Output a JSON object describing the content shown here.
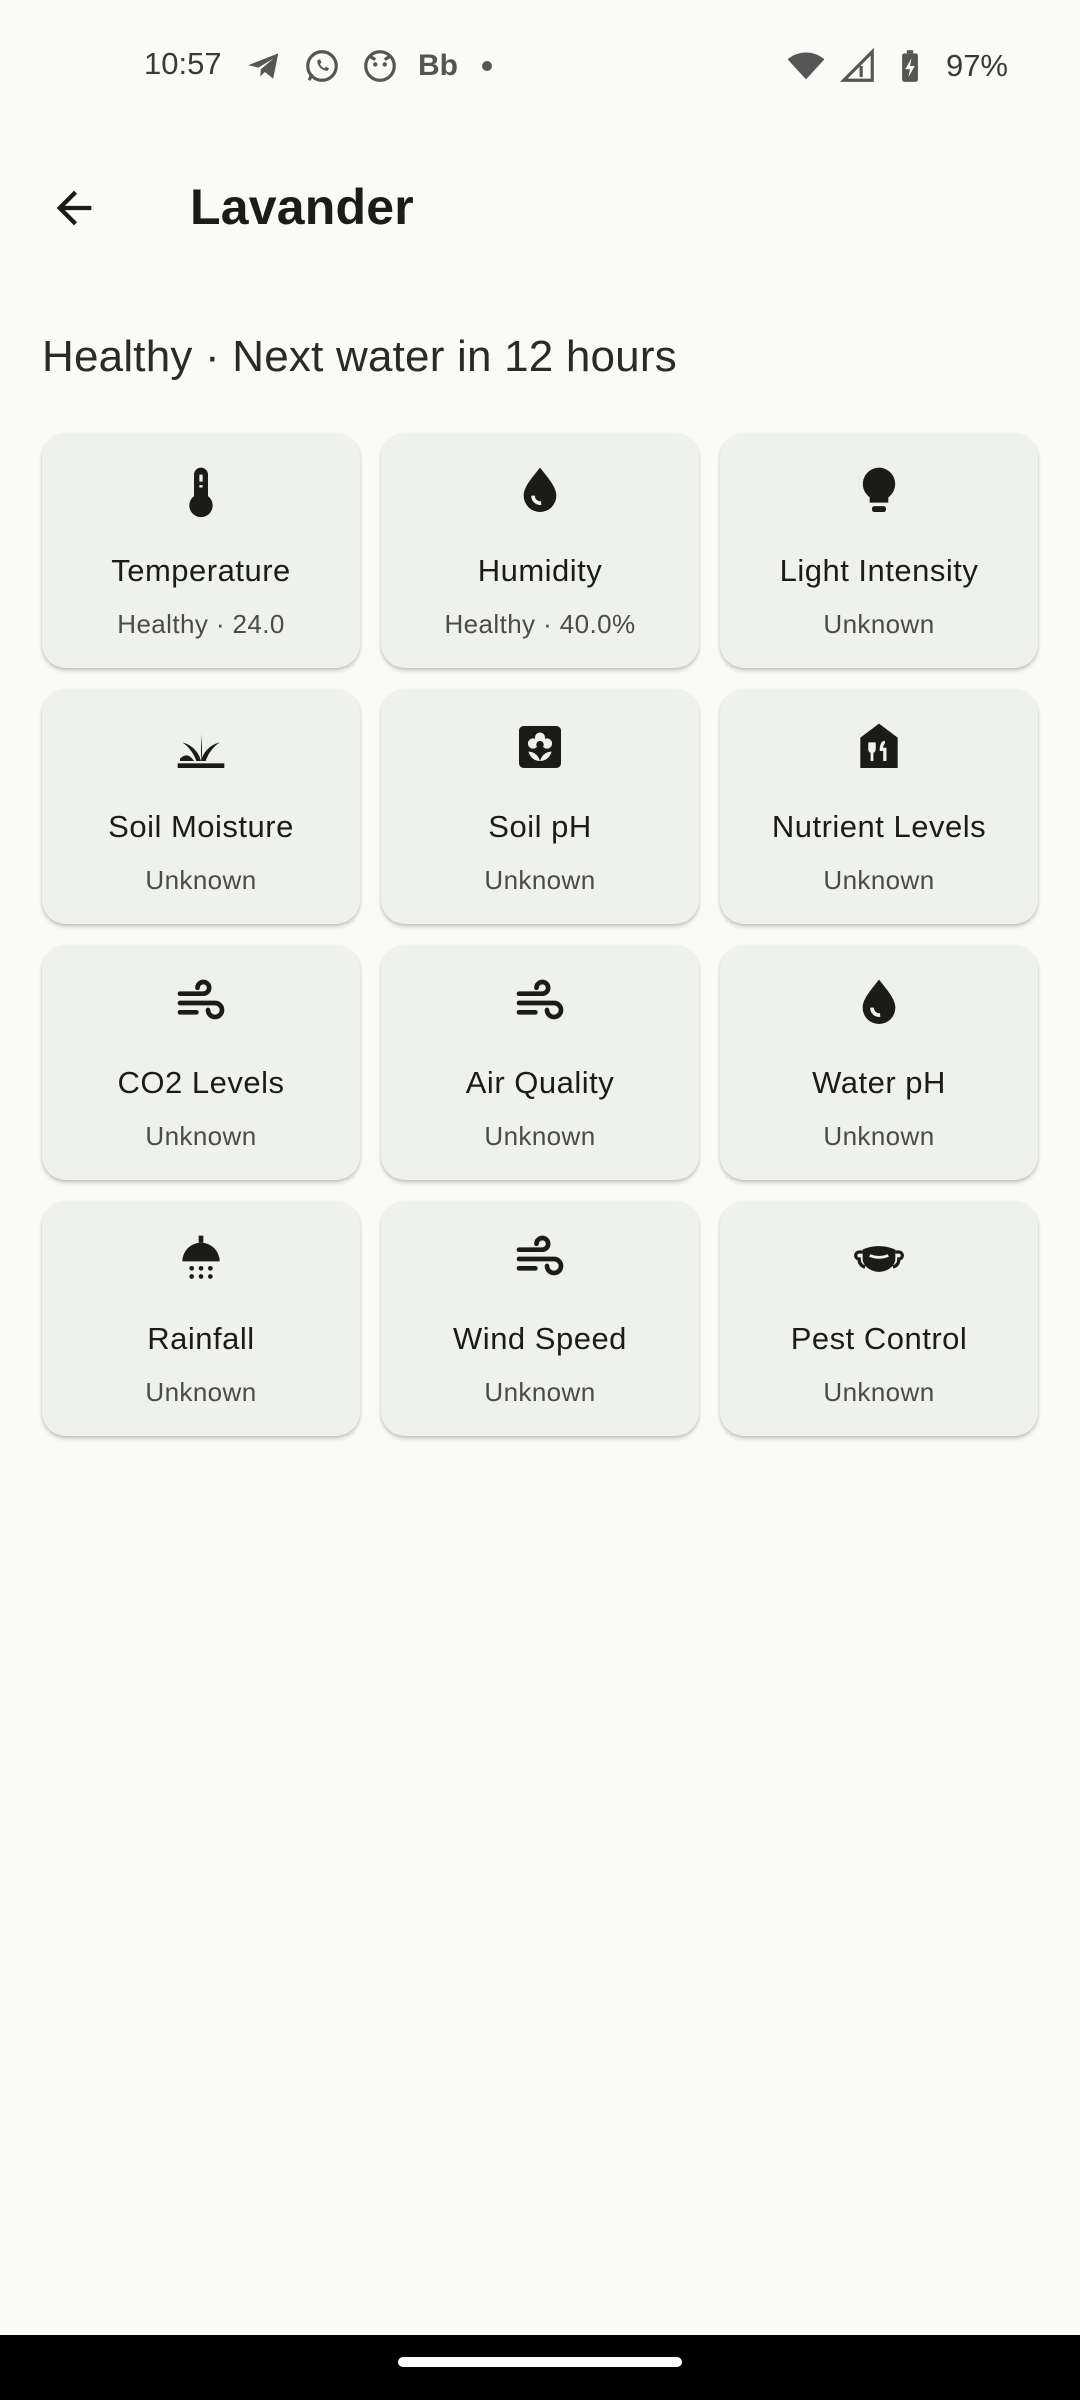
{
  "status_bar": {
    "time": "10:57",
    "left_icons": [
      "telegram-icon",
      "whatsapp-icon",
      "cat-icon",
      "bb-icon",
      "dot-icon"
    ],
    "bb_label": "Bb",
    "right_icons": [
      "wifi-icon",
      "signal-icon",
      "battery-charging-icon"
    ],
    "battery": "97%"
  },
  "app_bar": {
    "back_icon": "arrow-back-icon",
    "title": "Lavander"
  },
  "summary": "Healthy · Next water in 12 hours",
  "colors": {
    "background": "#fafbf5",
    "card": "#eef2ea",
    "text": "#1b1c18"
  },
  "cards": [
    {
      "title": "Temperature",
      "status": "Healthy · 24.0",
      "icon": "thermometer-icon"
    },
    {
      "title": "Humidity",
      "status": "Healthy · 40.0%",
      "icon": "water-drop-icon"
    },
    {
      "title": "Light Intensity",
      "status": "Unknown",
      "icon": "lightbulb-icon"
    },
    {
      "title": "Soil Moisture",
      "status": "Unknown",
      "icon": "grass-icon"
    },
    {
      "title": "Soil pH",
      "status": "Unknown",
      "icon": "local-florist-icon"
    },
    {
      "title": "Nutrient Levels",
      "status": "Unknown",
      "icon": "restaurant-house-icon"
    },
    {
      "title": "CO2 Levels",
      "status": "Unknown",
      "icon": "air-icon"
    },
    {
      "title": "Air Quality",
      "status": "Unknown",
      "icon": "air-icon"
    },
    {
      "title": "Water pH",
      "status": "Unknown",
      "icon": "water-drop-icon"
    },
    {
      "title": "Rainfall",
      "status": "Unknown",
      "icon": "shower-icon"
    },
    {
      "title": "Wind Speed",
      "status": "Unknown",
      "icon": "air-icon"
    },
    {
      "title": "Pest Control",
      "status": "Unknown",
      "icon": "mask-icon"
    }
  ]
}
